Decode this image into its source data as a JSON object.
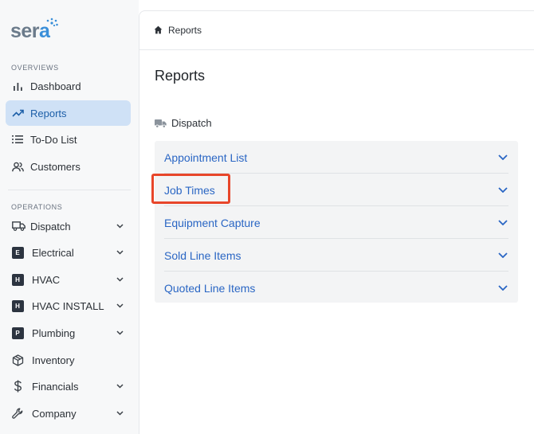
{
  "brand": {
    "logo_prefix": "ser",
    "logo_suffix": "a"
  },
  "sidebar": {
    "sections": [
      {
        "label": "OVERVIEWS"
      },
      {
        "label": "OPERATIONS"
      }
    ],
    "overviews": [
      {
        "label": "Dashboard",
        "icon": "bar-chart-icon"
      },
      {
        "label": "Reports",
        "icon": "trend-up-icon",
        "active": true
      },
      {
        "label": "To-Do List",
        "icon": "list-icon"
      },
      {
        "label": "Customers",
        "icon": "users-icon"
      }
    ],
    "operations": [
      {
        "label": "Dispatch",
        "icon": "truck-icon"
      },
      {
        "label": "Electrical",
        "badge": "E"
      },
      {
        "label": "HVAC",
        "badge": "H"
      },
      {
        "label": "HVAC INSTALL",
        "badge": "H"
      },
      {
        "label": "Plumbing",
        "badge": "P"
      },
      {
        "label": "Inventory",
        "icon": "box-icon"
      },
      {
        "label": "Financials",
        "icon": "dollar-icon"
      },
      {
        "label": "Company",
        "icon": "wrench-icon"
      }
    ]
  },
  "breadcrumb": {
    "label": "Reports"
  },
  "page": {
    "title": "Reports",
    "group": "Dispatch",
    "reports": [
      {
        "label": "Appointment List"
      },
      {
        "label": "Job Times"
      },
      {
        "label": "Equipment Capture"
      },
      {
        "label": "Sold Line Items"
      },
      {
        "label": "Quoted Line Items"
      }
    ]
  },
  "colors": {
    "accent": "#2a66c4",
    "active_bg": "#cfe1f6",
    "highlight": "#e8462a"
  }
}
